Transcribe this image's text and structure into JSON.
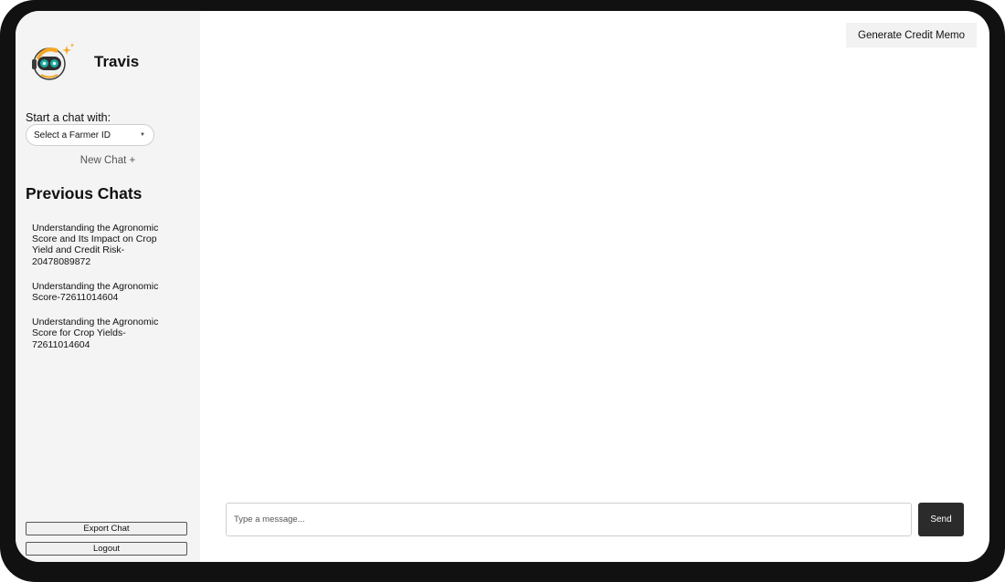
{
  "app": {
    "name": "Travis",
    "logo_icon": "robot-astronaut-icon"
  },
  "sidebar": {
    "start_label": "Start a chat with:",
    "farmer_select": {
      "value": "Select a Farmer ID"
    },
    "new_chat_label": "New Chat +",
    "previous_chats_title": "Previous Chats",
    "chats": [
      {
        "title": "Understanding the Agronomic Score and Its Impact on Crop Yield and Credit Risk-20478089872"
      },
      {
        "title": "Understanding the Agronomic Score-72611014604"
      },
      {
        "title": "Understanding the Agronomic Score for Crop Yields-72611014604"
      }
    ],
    "export_label": "Export Chat",
    "logout_label": "Logout"
  },
  "header": {
    "generate_memo_label": "Generate Credit Memo"
  },
  "composer": {
    "placeholder": "Type a message...",
    "value": "",
    "send_label": "Send"
  },
  "colors": {
    "sidebar_bg": "#f4f4f4",
    "send_bg": "#2b2b2b",
    "logo_accent": "#f5a623",
    "logo_teal": "#1aa9a0"
  }
}
